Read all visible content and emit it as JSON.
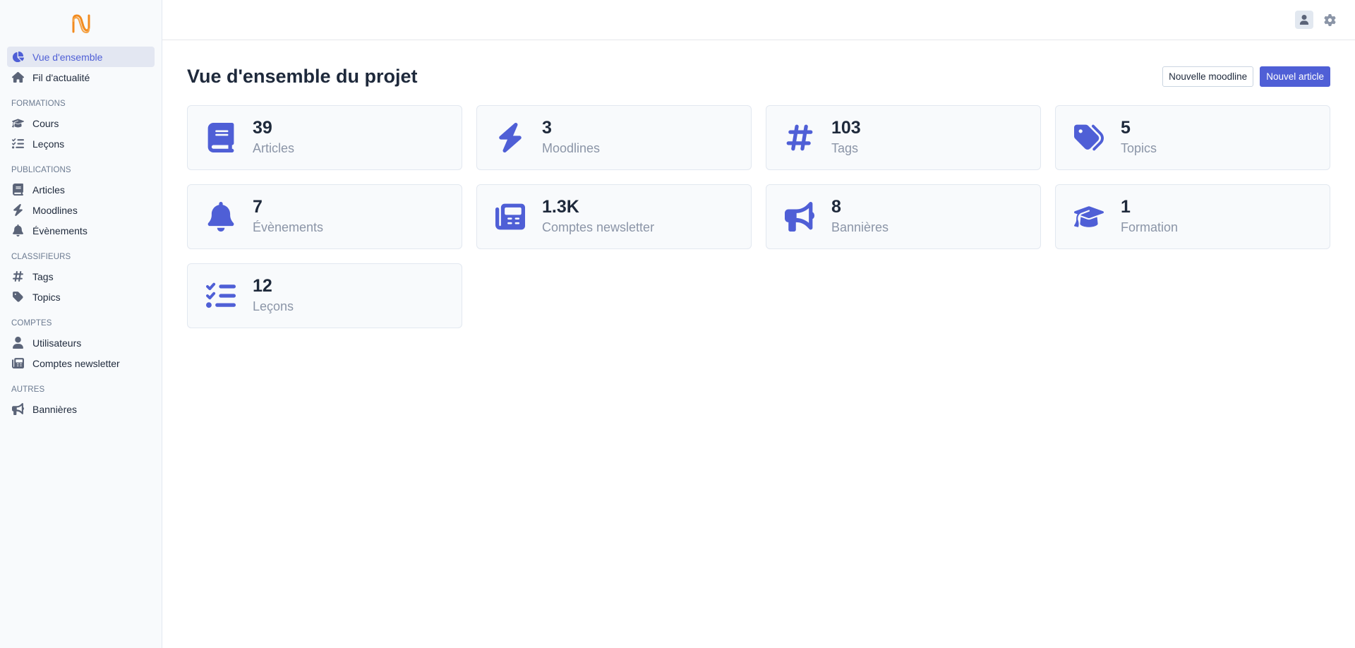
{
  "sidebar": {
    "top_items": [
      {
        "label": "Vue d'ensemble",
        "icon": "chart-pie-icon",
        "active": true
      },
      {
        "label": "Fil d'actualité",
        "icon": "home-icon"
      }
    ],
    "sections": [
      {
        "title": "FORMATIONS",
        "items": [
          {
            "label": "Cours",
            "icon": "graduation-cap-icon"
          },
          {
            "label": "Leçons",
            "icon": "list-check-icon"
          }
        ]
      },
      {
        "title": "PUBLICATIONS",
        "items": [
          {
            "label": "Articles",
            "icon": "book-icon"
          },
          {
            "label": "Moodlines",
            "icon": "bolt-icon"
          },
          {
            "label": "Évènements",
            "icon": "bell-icon"
          }
        ]
      },
      {
        "title": "CLASSIFIEURS",
        "items": [
          {
            "label": "Tags",
            "icon": "hashtag-icon"
          },
          {
            "label": "Topics",
            "icon": "tag-icon"
          }
        ]
      },
      {
        "title": "COMPTES",
        "items": [
          {
            "label": "Utilisateurs",
            "icon": "user-icon"
          },
          {
            "label": "Comptes newsletter",
            "icon": "newspaper-icon"
          }
        ]
      },
      {
        "title": "AUTRES",
        "items": [
          {
            "label": "Bannières",
            "icon": "bullhorn-icon"
          }
        ]
      }
    ]
  },
  "header": {
    "page_title": "Vue d'ensemble du projet",
    "secondary_button": "Nouvelle moodline",
    "primary_button": "Nouvel article"
  },
  "stats": [
    {
      "value": "39",
      "label": "Articles",
      "icon": "book-icon"
    },
    {
      "value": "3",
      "label": "Moodlines",
      "icon": "bolt-icon"
    },
    {
      "value": "103",
      "label": "Tags",
      "icon": "hashtag-icon"
    },
    {
      "value": "5",
      "label": "Topics",
      "icon": "tags-icon"
    },
    {
      "value": "7",
      "label": "Évènements",
      "icon": "bell-icon"
    },
    {
      "value": "1.3K",
      "label": "Comptes newsletter",
      "icon": "newspaper-icon"
    },
    {
      "value": "8",
      "label": "Bannières",
      "icon": "bullhorn-icon"
    },
    {
      "value": "1",
      "label": "Formation",
      "icon": "graduation-cap-icon"
    },
    {
      "value": "12",
      "label": "Leçons",
      "icon": "list-check-icon"
    }
  ],
  "colors": {
    "accent": "#4f5fd6",
    "logo": "#f28b1f",
    "sidebar_bg": "#f8fafc"
  }
}
